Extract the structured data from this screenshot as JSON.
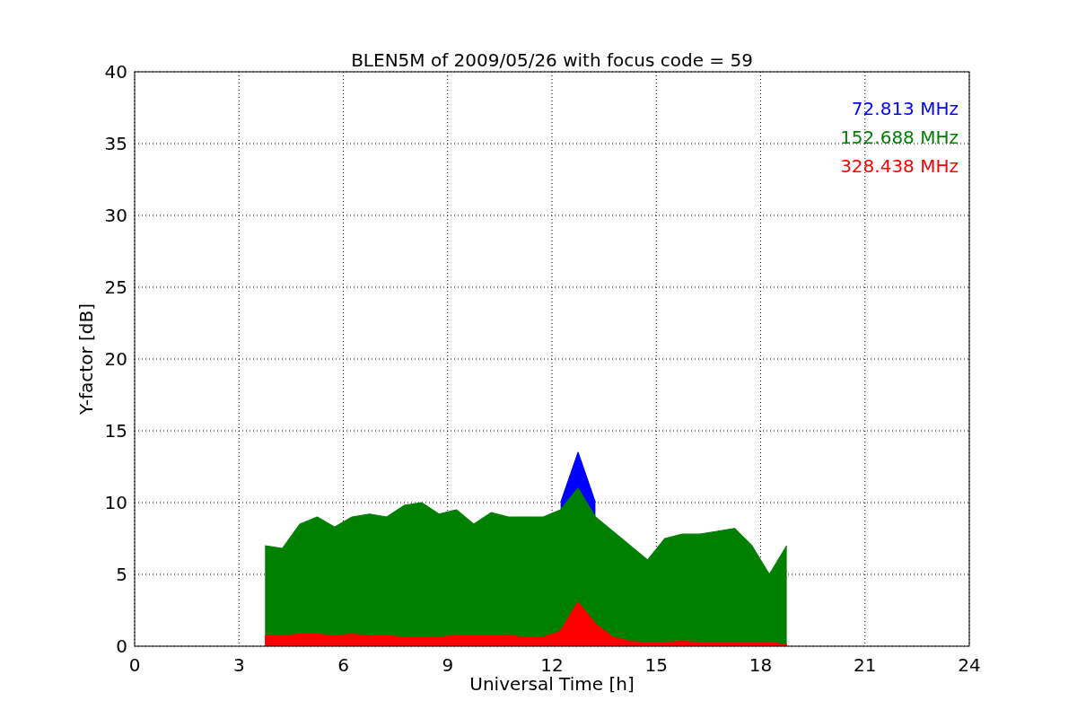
{
  "chart_data": {
    "type": "area",
    "title": "BLEN5M of 2009/05/26 with focus code = 59",
    "xlabel": "Universal Time [h]",
    "ylabel": "Y-factor [dB]",
    "x": [
      3.75,
      4.25,
      4.75,
      5.25,
      5.75,
      6.25,
      6.75,
      7.25,
      7.75,
      8.25,
      8.75,
      9.25,
      9.75,
      10.25,
      10.75,
      11.25,
      11.75,
      12.25,
      12.75,
      13.25,
      13.75,
      14.25,
      14.75,
      15.25,
      15.75,
      16.25,
      16.75,
      17.25,
      17.75,
      18.25,
      18.75
    ],
    "grid": true,
    "xlim": [
      0,
      24
    ],
    "ylim": [
      0,
      40
    ],
    "xticks": [
      0,
      3,
      6,
      9,
      12,
      15,
      18,
      21,
      24
    ],
    "yticks": [
      0,
      5,
      10,
      15,
      20,
      25,
      30,
      35,
      40
    ],
    "series": [
      {
        "name": "72.813 MHz",
        "color": "#0000ff",
        "values": [
          null,
          null,
          null,
          null,
          null,
          null,
          null,
          null,
          null,
          null,
          null,
          null,
          null,
          null,
          null,
          null,
          null,
          10,
          13.5,
          10,
          null,
          null,
          null,
          null,
          null,
          null,
          null,
          null,
          null,
          null,
          null
        ]
      },
      {
        "name": "152.688 MHz",
        "color": "#008000",
        "values": [
          7,
          6.8,
          8.5,
          9,
          8.3,
          9,
          9.2,
          9,
          9.8,
          10,
          9.2,
          9.5,
          8.5,
          9.3,
          9,
          9,
          9,
          9.5,
          11,
          9,
          8,
          7,
          6,
          7.5,
          7.8,
          7.8,
          8,
          8.2,
          7,
          5,
          7
        ]
      },
      {
        "name": "328.438 MHz",
        "color": "#ff0000",
        "values": [
          0.7,
          0.7,
          0.8,
          0.8,
          0.7,
          0.8,
          0.7,
          0.7,
          0.6,
          0.6,
          0.6,
          0.7,
          0.7,
          0.7,
          0.7,
          0.6,
          0.6,
          1,
          3,
          1.5,
          0.6,
          0.3,
          0.2,
          0.2,
          0.3,
          0.2,
          0.2,
          0.2,
          0.2,
          0.2,
          0.1
        ]
      }
    ]
  }
}
